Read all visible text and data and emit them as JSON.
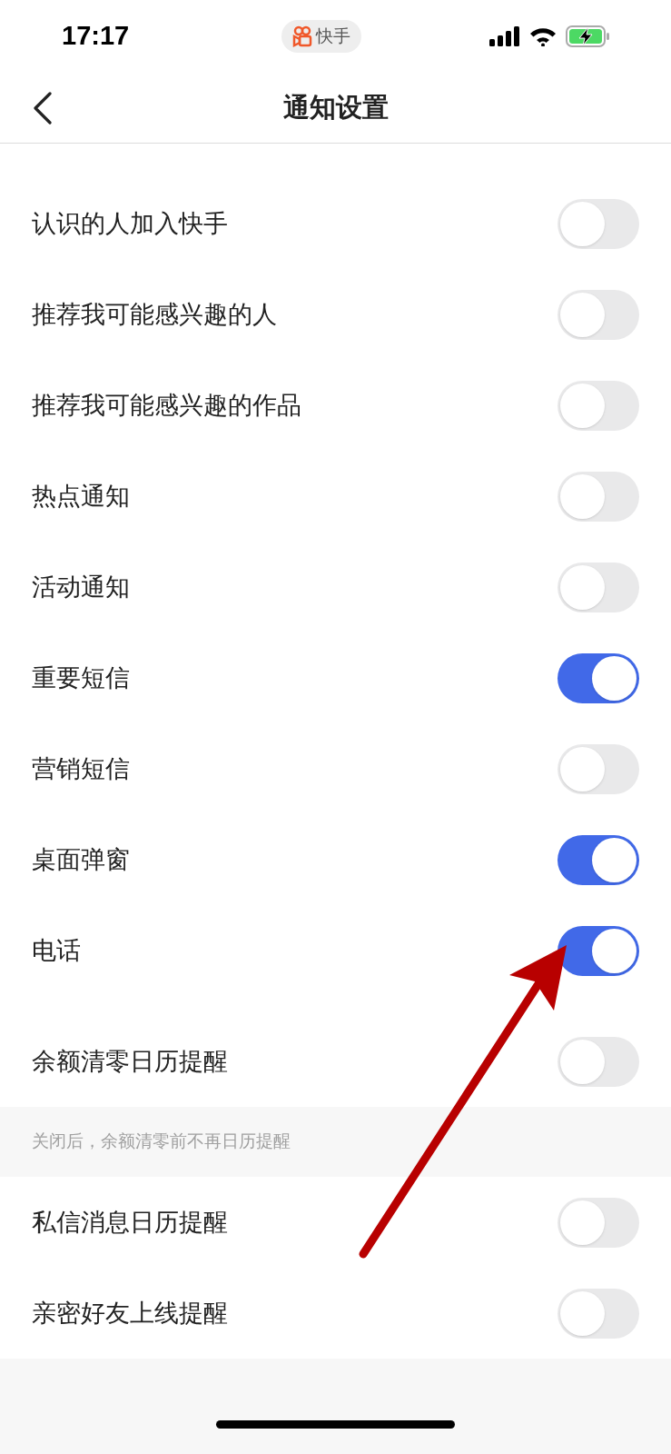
{
  "status_bar": {
    "time": "17:17",
    "app_badge": "快手"
  },
  "nav": {
    "title": "通知设置"
  },
  "settings": [
    {
      "label": "认识的人加入快手",
      "on": false
    },
    {
      "label": "推荐我可能感兴趣的人",
      "on": false
    },
    {
      "label": "推荐我可能感兴趣的作品",
      "on": false
    },
    {
      "label": "热点通知",
      "on": false
    },
    {
      "label": "活动通知",
      "on": false
    },
    {
      "label": "重要短信",
      "on": true
    },
    {
      "label": "营销短信",
      "on": false
    },
    {
      "label": "桌面弹窗",
      "on": true
    },
    {
      "label": "电话",
      "on": true
    },
    {
      "label": "余额清零日历提醒",
      "on": false
    }
  ],
  "note": "关闭后，余额清零前不再日历提醒",
  "settings_2": [
    {
      "label": "私信消息日历提醒",
      "on": false
    },
    {
      "label": "亲密好友上线提醒",
      "on": false
    }
  ]
}
